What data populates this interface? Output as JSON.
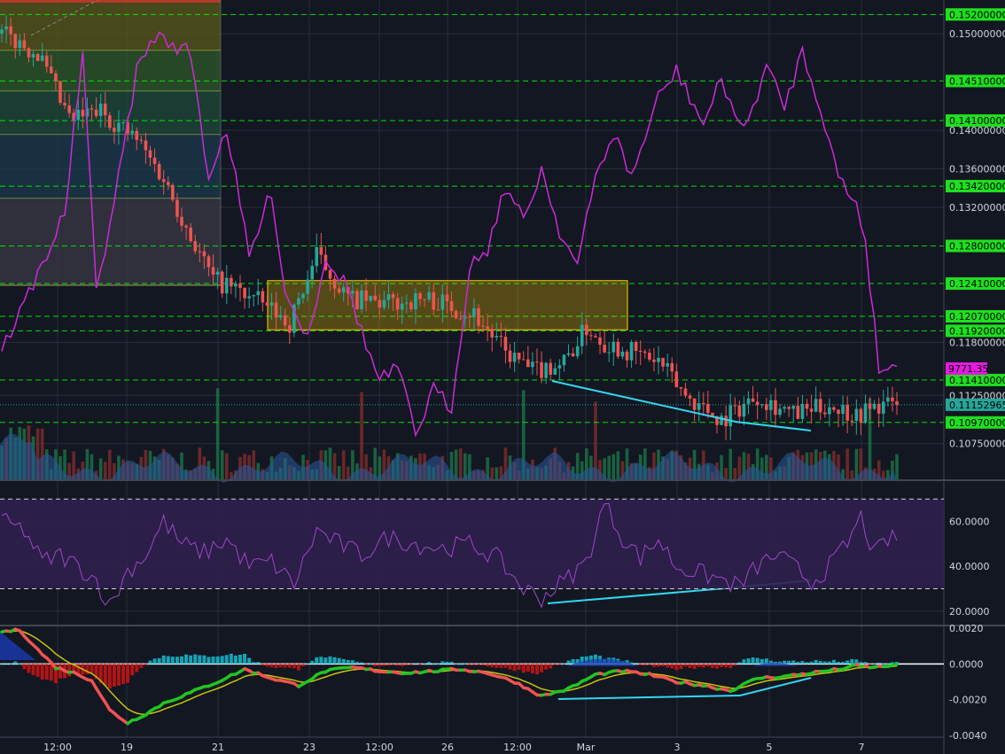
{
  "colors": {
    "background": "#131722",
    "grid": "#2a2e39",
    "up": "#26a69a",
    "down": "#ef5350",
    "level_line": "#00ff00",
    "level_tag": "#1fe01f",
    "overlay_line": "#cc2bd6",
    "overlay_tag": "#e51ae0",
    "divergence": "#33d6f2",
    "rsi_line": "#9d47c9",
    "rsi_band": "#2f1f4c",
    "macd_line": "#22c422",
    "signal_line": "#c4c40a",
    "macd_hist_up": "#16b3c4",
    "macd_hist_down": "#c41414",
    "consolidation_box": "#ffd200"
  },
  "chart_data": [
    {
      "type": "candlestick",
      "panel": "price",
      "x_ticks": [
        "12:00",
        "19",
        "21",
        "23",
        "12:00",
        "26",
        "12:00",
        "Mar",
        "3",
        "5",
        "7"
      ],
      "y_ticks": [
        0.15,
        0.14,
        0.136,
        0.132,
        0.118,
        0.1125,
        0.1075
      ],
      "y_tick_labels": [
        "0.15000000",
        "0.14000000",
        "0.13600000",
        "0.13200000",
        "0.11800000",
        "0.11250000",
        "0.10750000"
      ],
      "ylim": [
        0.1038,
        0.1535
      ],
      "grid": true,
      "horizontal_levels": [
        {
          "value": 0.152,
          "label": "0.15200000"
        },
        {
          "value": 0.1451,
          "label": "0.14510000"
        },
        {
          "value": 0.141,
          "label": "0.14100000"
        },
        {
          "value": 0.1342,
          "label": "0.13420000"
        },
        {
          "value": 0.128,
          "label": "0.12800000"
        },
        {
          "value": 0.1241,
          "label": "0.12410000"
        },
        {
          "value": 0.1207,
          "label": "0.12070000"
        },
        {
          "value": 0.1192,
          "label": "0.11920000"
        },
        {
          "value": 0.1141,
          "label": "0.11410000"
        },
        {
          "value": 0.1097,
          "label": "0.10970000"
        }
      ],
      "last_price": {
        "value": 0.11152965,
        "label": "0.11152965"
      },
      "overlay_last": {
        "label": "9771.35"
      },
      "consolidation_zone": {
        "top": 0.1244,
        "bottom": 0.1193
      },
      "close_anchors": [
        [
          0,
          0.15
        ],
        [
          8,
          0.148
        ],
        [
          15,
          0.141
        ],
        [
          22,
          0.142
        ],
        [
          30,
          0.139
        ],
        [
          36,
          0.135
        ],
        [
          42,
          0.129
        ],
        [
          47,
          0.1245
        ],
        [
          52,
          0.1235
        ],
        [
          58,
          0.122
        ],
        [
          64,
          0.12
        ],
        [
          70,
          0.127
        ],
        [
          77,
          0.1225
        ],
        [
          85,
          0.122
        ],
        [
          95,
          0.1225
        ],
        [
          105,
          0.121
        ],
        [
          112,
          0.117
        ],
        [
          118,
          0.115
        ],
        [
          125,
          0.116
        ],
        [
          130,
          0.1195
        ],
        [
          134,
          0.118
        ],
        [
          140,
          0.117
        ],
        [
          146,
          0.116
        ],
        [
          152,
          0.1125
        ],
        [
          160,
          0.11
        ],
        [
          168,
          0.1125
        ],
        [
          176,
          0.1105
        ],
        [
          184,
          0.1115
        ],
        [
          190,
          0.1105
        ],
        [
          195,
          0.1115
        ]
      ]
    },
    {
      "type": "line",
      "panel": "price-overlay",
      "series": [
        {
          "values_px": "overlay"
        }
      ],
      "anchors": [
        [
          0,
          395
        ],
        [
          8,
          310
        ],
        [
          14,
          240
        ],
        [
          18,
          60
        ],
        [
          21,
          330
        ],
        [
          26,
          200
        ],
        [
          30,
          80
        ],
        [
          34,
          40
        ],
        [
          42,
          60
        ],
        [
          46,
          200
        ],
        [
          50,
          145
        ],
        [
          55,
          290
        ],
        [
          60,
          215
        ],
        [
          63,
          330
        ],
        [
          68,
          380
        ],
        [
          72,
          290
        ],
        [
          77,
          325
        ],
        [
          81,
          390
        ],
        [
          84,
          430
        ],
        [
          88,
          415
        ],
        [
          92,
          490
        ],
        [
          96,
          440
        ],
        [
          100,
          460
        ],
        [
          104,
          300
        ],
        [
          108,
          280
        ],
        [
          112,
          210
        ],
        [
          116,
          250
        ],
        [
          120,
          190
        ],
        [
          124,
          260
        ],
        [
          128,
          300
        ],
        [
          132,
          200
        ],
        [
          136,
          150
        ],
        [
          140,
          200
        ],
        [
          146,
          110
        ],
        [
          150,
          80
        ],
        [
          156,
          140
        ],
        [
          160,
          90
        ],
        [
          165,
          150
        ],
        [
          170,
          75
        ],
        [
          174,
          120
        ],
        [
          178,
          58
        ],
        [
          182,
          120
        ],
        [
          186,
          200
        ],
        [
          190,
          230
        ],
        [
          192,
          270
        ],
        [
          195,
          415
        ],
        [
          197,
          415
        ]
      ]
    },
    {
      "type": "line",
      "panel": "rsi",
      "y_ticks": [
        60,
        40,
        20
      ],
      "y_tick_labels": [
        "60.0000",
        "40.0000",
        "20.0000"
      ],
      "ylim": [
        14,
        78
      ],
      "bands": [
        70,
        30
      ],
      "anchors": [
        [
          0,
          60
        ],
        [
          5,
          56
        ],
        [
          9,
          42
        ],
        [
          13,
          45
        ],
        [
          17,
          40
        ],
        [
          21,
          34
        ],
        [
          24,
          22
        ],
        [
          28,
          38
        ],
        [
          32,
          45
        ],
        [
          36,
          60
        ],
        [
          40,
          50
        ],
        [
          45,
          46
        ],
        [
          50,
          52
        ],
        [
          55,
          40
        ],
        [
          60,
          42
        ],
        [
          65,
          32
        ],
        [
          70,
          56
        ],
        [
          75,
          50
        ],
        [
          80,
          45
        ],
        [
          86,
          53
        ],
        [
          92,
          50
        ],
        [
          98,
          48
        ],
        [
          104,
          50
        ],
        [
          110,
          44
        ],
        [
          116,
          30
        ],
        [
          120,
          26
        ],
        [
          126,
          35
        ],
        [
          130,
          42
        ],
        [
          134,
          68
        ],
        [
          138,
          53
        ],
        [
          142,
          44
        ],
        [
          146,
          52
        ],
        [
          150,
          40
        ],
        [
          155,
          37
        ],
        [
          160,
          34
        ],
        [
          164,
          31
        ],
        [
          168,
          40
        ],
        [
          172,
          45
        ],
        [
          176,
          40
        ],
        [
          180,
          33
        ],
        [
          184,
          40
        ],
        [
          188,
          50
        ],
        [
          191,
          62
        ],
        [
          194,
          45
        ],
        [
          197,
          52
        ]
      ]
    },
    {
      "type": "bar",
      "panel": "macd",
      "y_ticks": [
        0.002,
        0,
        -0.002,
        -0.004
      ],
      "y_tick_labels": [
        "0.0020",
        "0.0000",
        "-0.0020",
        "-0.0040"
      ],
      "ylim": [
        -0.0041,
        0.0021
      ],
      "macd_anchors": [
        [
          0,
          0.0018
        ],
        [
          4,
          0.0019
        ],
        [
          8,
          0.0008
        ],
        [
          12,
          -0.0002
        ],
        [
          16,
          -0.0005
        ],
        [
          20,
          -0.0009
        ],
        [
          24,
          -0.0026
        ],
        [
          28,
          -0.0033
        ],
        [
          32,
          -0.0028
        ],
        [
          36,
          -0.0022
        ],
        [
          42,
          -0.0016
        ],
        [
          48,
          -0.001
        ],
        [
          54,
          -0.0003
        ],
        [
          60,
          -0.0008
        ],
        [
          66,
          -0.0012
        ],
        [
          72,
          -0.0004
        ],
        [
          78,
          -0.0002
        ],
        [
          84,
          -0.0004
        ],
        [
          90,
          -0.0005
        ],
        [
          96,
          -0.0004
        ],
        [
          102,
          -0.0003
        ],
        [
          108,
          -0.0005
        ],
        [
          114,
          -0.001
        ],
        [
          120,
          -0.0018
        ],
        [
          126,
          -0.0014
        ],
        [
          132,
          -0.0006
        ],
        [
          138,
          -0.0004
        ],
        [
          144,
          -0.0006
        ],
        [
          150,
          -0.001
        ],
        [
          156,
          -0.0012
        ],
        [
          162,
          -0.0015
        ],
        [
          168,
          -0.0008
        ],
        [
          174,
          -0.0007
        ],
        [
          180,
          -0.0005
        ],
        [
          186,
          -0.0003
        ],
        [
          190,
          -0.0001
        ],
        [
          194,
          -0.0002
        ],
        [
          197,
          -0.0001
        ]
      ]
    }
  ]
}
